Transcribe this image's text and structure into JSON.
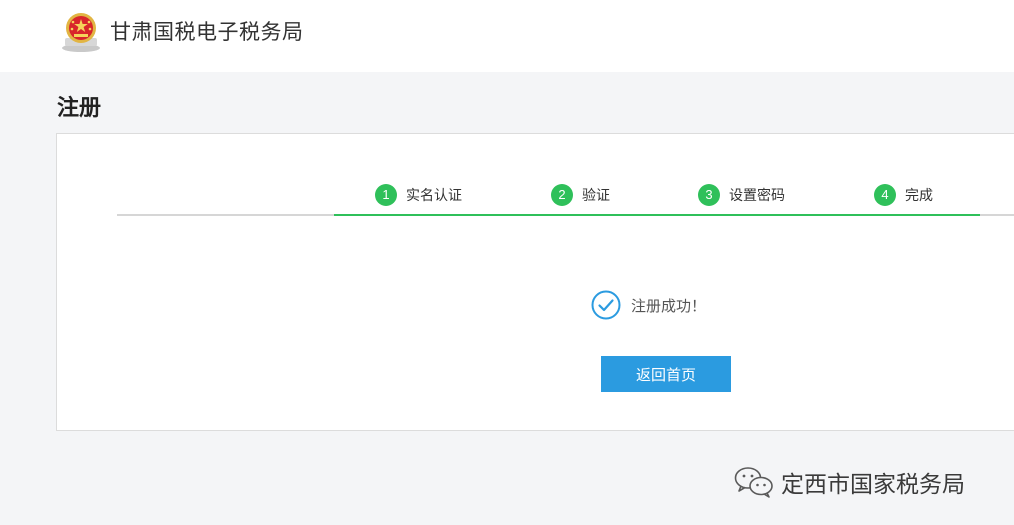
{
  "header": {
    "site_title": "甘肃国税电子税务局"
  },
  "page": {
    "title": "注册"
  },
  "steps": [
    {
      "number": "1",
      "label": "实名认证"
    },
    {
      "number": "2",
      "label": "验证"
    },
    {
      "number": "3",
      "label": "设置密码"
    },
    {
      "number": "4",
      "label": "完成"
    }
  ],
  "result": {
    "message": "注册成功！",
    "icon": "check-circle-icon"
  },
  "actions": {
    "home_label": "返回首页"
  },
  "watermark": {
    "text": "定西市国家税务局",
    "icon": "wechat-icon"
  },
  "colors": {
    "step_green": "#2fc05a",
    "button_blue": "#2b9be0",
    "check_blue": "#2b9be0"
  }
}
